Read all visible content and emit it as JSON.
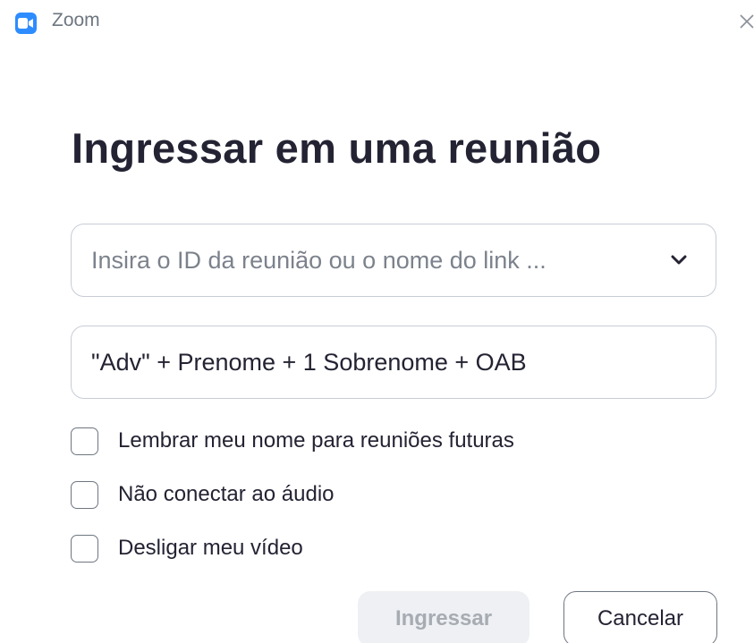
{
  "window": {
    "app_title": "Zoom",
    "icon": "zoom-camera-icon",
    "close_icon": "close-icon"
  },
  "dialog": {
    "heading": "Ingressar em uma reunião",
    "meeting_field": {
      "placeholder": "Insira o ID da reunião ou o nome do link ...",
      "value": "",
      "dropdown_icon": "chevron-down-icon"
    },
    "name_field": {
      "value": "\"Adv\" + Prenome + 1 Sobrenome + OAB"
    },
    "options": [
      {
        "label": "Lembrar meu nome para reuniões futuras",
        "checked": false
      },
      {
        "label": "Não conectar ao áudio",
        "checked": false
      },
      {
        "label": "Desligar meu vídeo",
        "checked": false
      }
    ],
    "buttons": {
      "join_label": "Ingressar",
      "join_enabled": false,
      "cancel_label": "Cancelar"
    }
  },
  "colors": {
    "accent": "#2d8cff",
    "text": "#232333",
    "border": "#c7ccd6",
    "disabled_bg": "#eef0f3",
    "disabled_text": "#a7acb3"
  }
}
